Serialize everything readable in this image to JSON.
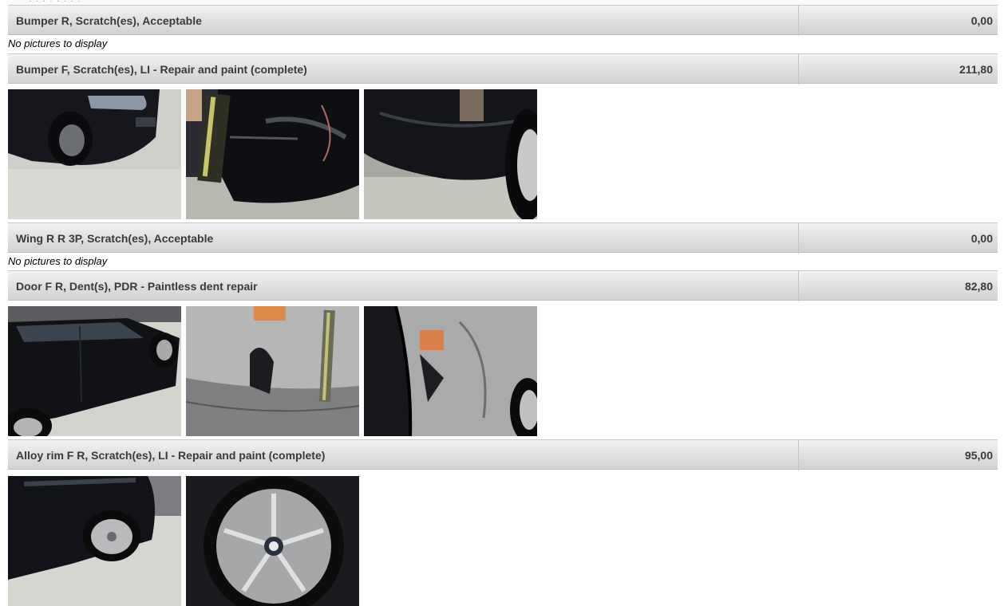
{
  "damage_items": [
    {
      "label": "Bumper R, Scratch(es), Acceptable",
      "amount": "0,00",
      "no_pictures": "No pictures to display",
      "photos": []
    },
    {
      "label": "Bumper F, Scratch(es), LI - Repair and paint (complete)",
      "amount": "211,80",
      "no_pictures": "",
      "photos": [
        "bumper-front-overview",
        "bumper-front-measure-closeup",
        "bumper-front-closeup"
      ]
    },
    {
      "label": "Wing R R 3P, Scratch(es), Acceptable",
      "amount": "0,00",
      "no_pictures": "No pictures to display",
      "photos": []
    },
    {
      "label": "Door F R, Dent(s), PDR - Paintless dent repair",
      "amount": "82,80",
      "no_pictures": "",
      "photos": [
        "door-front-right-overview",
        "door-dent-measure-closeup",
        "door-dent-closeup"
      ]
    },
    {
      "label": "Alloy rim F R, Scratch(es), LI - Repair and paint (complete)",
      "amount": "95,00",
      "no_pictures": "",
      "photos": [
        "alloy-rim-overview",
        "alloy-rim-closeup"
      ]
    }
  ]
}
